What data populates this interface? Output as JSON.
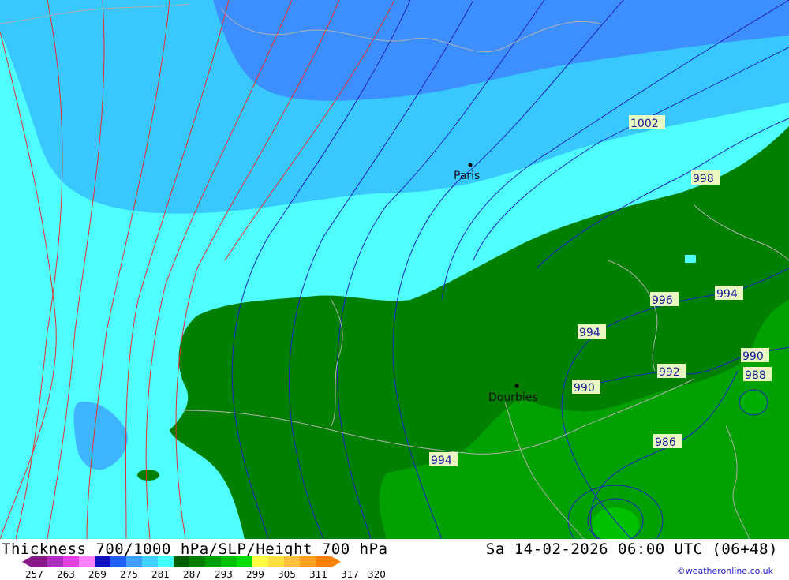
{
  "title": {
    "left": "Thickness 700/1000 hPa/SLP/Height 700 hPa",
    "right": "Sa 14-02-2026 06:00 UTC (06+48)"
  },
  "credit": "©weatheronline.co.uk",
  "cities": [
    {
      "name": "Paris"
    },
    {
      "name": "Dourbies"
    }
  ],
  "pressure_labels": [
    "1002",
    "998",
    "996",
    "994",
    "994",
    "994",
    "990",
    "992",
    "990",
    "988",
    "986"
  ],
  "colors": {
    "ocean_blue_dark": "#3d8fff",
    "blue_mid": "#3fb4ff",
    "cyan_light": "#38c8ff",
    "cyan": "#4fffff",
    "green_dark": "#007f00",
    "green_mid": "#00a000",
    "green_bright": "#00c000",
    "thickness_red": "#e03030",
    "isobar_blue": "#2020c0",
    "border_gray": "#b0b0b0"
  },
  "scale": {
    "values": [
      "257",
      "263",
      "269",
      "275",
      "281",
      "287",
      "293",
      "299",
      "305",
      "311",
      "317",
      "320"
    ],
    "colors": [
      "#8a1a8a",
      "#b030c0",
      "#e040e0",
      "#ff80ff",
      "#1010c0",
      "#2060ff",
      "#3f9fff",
      "#3fd0ff",
      "#40ffff",
      "#006000",
      "#008000",
      "#00a000",
      "#00c000",
      "#00e000",
      "#ffff40",
      "#ffe040",
      "#ffc040",
      "#ffa020",
      "#ff8000"
    ]
  }
}
